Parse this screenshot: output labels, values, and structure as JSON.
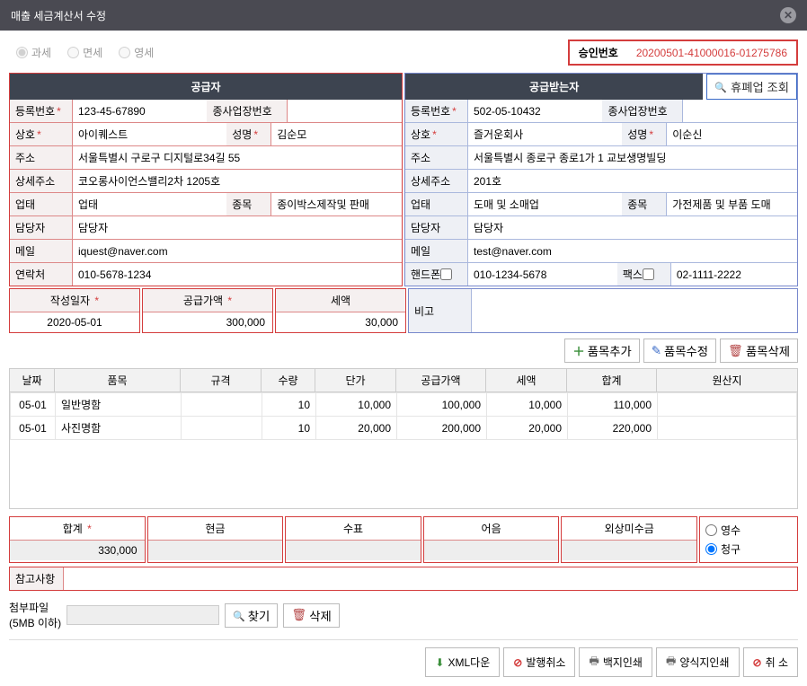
{
  "window": {
    "title": "매출 세금계산서 수정"
  },
  "tax_type": {
    "opt1": "과세",
    "opt2": "면세",
    "opt3": "영세"
  },
  "approval": {
    "label": "승인번호",
    "value": "20200501-41000016-01275786"
  },
  "supplier": {
    "header": "공급자",
    "reg_no_lbl": "등록번호",
    "reg_no": "123-45-67890",
    "sub_biz_lbl": "종사업장번호",
    "sub_biz": "",
    "company_lbl": "상호",
    "company": "아이퀘스트",
    "ceo_lbl": "성명",
    "ceo": "김순모",
    "addr_lbl": "주소",
    "addr": "서울특별시 구로구 디지털로34길 55",
    "addr2_lbl": "상세주소",
    "addr2": "코오롱사이언스밸리2차 1205호",
    "biz_type_lbl": "업태",
    "biz_type": "업태",
    "biz_item_lbl": "종목",
    "biz_item": "종이박스제작및 판매",
    "mgr_lbl": "담당자",
    "mgr": "담당자",
    "email_lbl": "메일",
    "email": "iquest@naver.com",
    "phone_lbl": "연락처",
    "phone": "010-5678-1234"
  },
  "buyer": {
    "header": "공급받는자",
    "biz_check_btn": "휴폐업 조회",
    "reg_no_lbl": "등록번호",
    "reg_no": "502-05-10432",
    "sub_biz_lbl": "종사업장번호",
    "sub_biz": "",
    "company_lbl": "상호",
    "company": "즐거운회사",
    "ceo_lbl": "성명",
    "ceo": "이순신",
    "addr_lbl": "주소",
    "addr": "서울특별시 종로구 종로1가 1 교보생명빌딩",
    "addr2_lbl": "상세주소",
    "addr2": "201호",
    "biz_type_lbl": "업태",
    "biz_type": "도매 및 소매업",
    "biz_item_lbl": "종목",
    "biz_item": "가전제품 및 부품 도매",
    "mgr_lbl": "담당자",
    "mgr": "담당자",
    "email_lbl": "메일",
    "email": "test@naver.com",
    "mobile_lbl": "핸드폰",
    "mobile": "010-1234-5678",
    "fax_lbl": "팩스",
    "fax": "02-1111-2222"
  },
  "summary": {
    "date_lbl": "작성일자",
    "date": "2020-05-01",
    "supply_lbl": "공급가액",
    "supply": "300,000",
    "tax_lbl": "세액",
    "tax": "30,000",
    "note_lbl": "비고"
  },
  "item_btns": {
    "add": "품목추가",
    "edit": "품목수정",
    "del": "품목삭제"
  },
  "item_headers": {
    "date": "날짜",
    "name": "품목",
    "spec": "규격",
    "qty": "수량",
    "price": "단가",
    "supply": "공급가액",
    "tax": "세액",
    "total": "합계",
    "origin": "원산지"
  },
  "items": [
    {
      "date": "05-01",
      "name": "일반명함",
      "spec": "",
      "qty": "10",
      "price": "10,000",
      "supply": "100,000",
      "tax": "10,000",
      "total": "110,000"
    },
    {
      "date": "05-01",
      "name": "사진명함",
      "spec": "",
      "qty": "10",
      "price": "20,000",
      "supply": "200,000",
      "tax": "20,000",
      "total": "220,000"
    }
  ],
  "totals": {
    "sum_lbl": "합계",
    "sum": "330,000",
    "cash_lbl": "현금",
    "cash": "",
    "check_lbl": "수표",
    "check": "",
    "note_lbl": "어음",
    "note": "",
    "credit_lbl": "외상미수금",
    "credit": "",
    "receipt_opt1": "영수",
    "receipt_opt2": "청구"
  },
  "ref": {
    "label": "참고사항"
  },
  "attach": {
    "label": "첨부파일",
    "sub": "(5MB 이하)",
    "find": "찾기",
    "del": "삭제"
  },
  "footer": {
    "xml": "XML다운",
    "cancel_issue": "발행취소",
    "print_blank": "백지인쇄",
    "print_form": "양식지인쇄",
    "cancel": "취 소"
  }
}
